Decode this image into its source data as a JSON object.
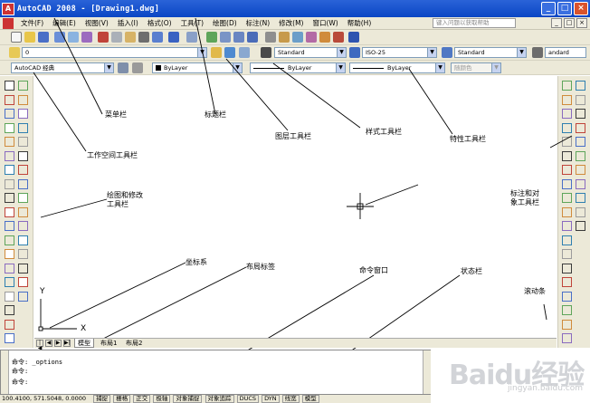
{
  "title": "AutoCAD 2008 - [Drawing1.dwg]",
  "menu": [
    "文件(F)",
    "编辑(E)",
    "视图(V)",
    "插入(I)",
    "格式(O)",
    "工具(T)",
    "绘图(D)",
    "标注(N)",
    "修改(M)",
    "窗口(W)",
    "帮助(H)"
  ],
  "help_placeholder": "键入问题以获取帮助",
  "layer_value": "0",
  "text_style": "Standard",
  "dim_style": "ISO-25",
  "table_style": "Standard",
  "mleader_style": "andard",
  "workspace": "AutoCAD 经典",
  "color_value": "ByLayer",
  "linetype_value": "ByLayer",
  "lineweight_value": "ByLayer",
  "plotstyle_value": "随颜色",
  "annotations": {
    "menu_bar": "菜单栏",
    "title_bar": "标题栏",
    "layers_toolbar": "图层工具栏",
    "styles_toolbar": "样式工具栏",
    "properties_toolbar": "特性工具栏",
    "workspace_toolbar": "工作空间工具栏",
    "draw_modify_1": "绘图和修改",
    "draw_modify_2": "工具栏",
    "dim_toolbar_1": "标注和对",
    "dim_toolbar_2": "象工具栏",
    "ucs": "坐标系",
    "layout_tabs": "布局标签",
    "command_window": "命令窗口",
    "status_bar": "状态栏",
    "scrollbar": "滚动条"
  },
  "ucs": {
    "y": "Y",
    "x": "X"
  },
  "tabs": [
    "模型",
    "布局1",
    "布局2"
  ],
  "command": {
    "line1": "命令: _options",
    "line2": "命令:",
    "line3": "命令:"
  },
  "status": {
    "coords": "100.4100, 571.5048, 0.0000",
    "buttons": [
      "捕捉",
      "栅格",
      "正交",
      "极轴",
      "对象捕捉",
      "对象追踪",
      "DUCS",
      "DYN",
      "线宽",
      "模型"
    ]
  },
  "watermark": {
    "text": "Baidu经验",
    "sub": "jingyan.baidu.com"
  },
  "colors": {
    "title_bar": "#0a46c4",
    "chrome": "#ece9d8",
    "annotation_line": "#000000"
  }
}
